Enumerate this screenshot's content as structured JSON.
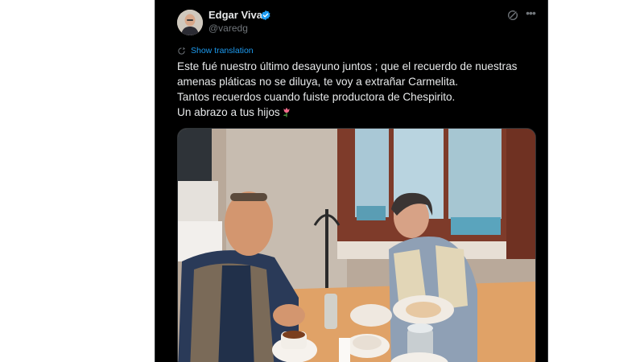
{
  "tweet": {
    "author_name": "Edgar Vivar",
    "author_handle": "@varedg",
    "verified": true,
    "show_translation_label": "Show translation",
    "text_lines": [
      "Este fué nuestro último desayuno juntos ; que el recuerdo de nuestras",
      "amenas pláticas no se diluya, te voy a extrañar Carmelita.",
      "Tantos recuerdos cuando fuiste productora de Chespirito.",
      "Un abrazo a tus hijos"
    ],
    "trailing_emoji": "tulip-emoji-icon"
  },
  "icons": {
    "avatar": "avatar",
    "verified": "verified-badge-icon",
    "grok": "grok-icon",
    "more": "more-options-icon",
    "translate": "translate-icon"
  },
  "colors": {
    "background": "#000000",
    "text_primary": "#e7e9ea",
    "text_secondary": "#71767b",
    "accent": "#1d9bf0",
    "border": "#2f3336"
  }
}
